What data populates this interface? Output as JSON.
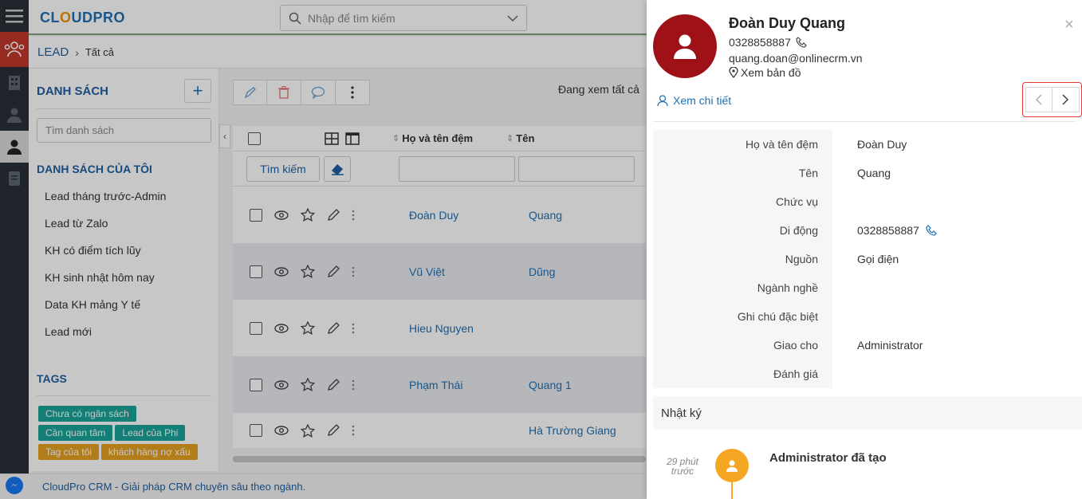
{
  "app": {
    "logo_text": "CLOUDPRO",
    "search_placeholder": "Nhập để tìm kiếm"
  },
  "breadcrumb": {
    "module": "LEAD",
    "view": "Tất cả"
  },
  "sidebar": {
    "title": "DANH SÁCH",
    "search_placeholder": "Tìm danh sách",
    "my_lists_title": "DANH SÁCH CỦA TÔI",
    "lists": [
      "Lead tháng trước-Admin",
      "Lead từ Zalo",
      "KH có điểm tích lũy",
      "KH sinh nhật hôm nay",
      "Data KH mảng Y tế",
      "Lead mới"
    ],
    "tags_title": "TAGS",
    "tags": [
      {
        "label": "Chưa có ngân sách",
        "color": "#1aa398"
      },
      {
        "label": "Cần quan tâm",
        "color": "#1aa398"
      },
      {
        "label": "Lead của Phi",
        "color": "#1aa398"
      },
      {
        "label": "Tag của tôi",
        "color": "#e6a020"
      },
      {
        "label": "khách hàng nợ xấu",
        "color": "#e6a020"
      }
    ]
  },
  "list": {
    "viewing_text": "Đang xem tất cả",
    "columns": {
      "middle_name": "Họ và tên đệm",
      "first_name": "Tên"
    },
    "search_button": "Tìm kiếm",
    "rows": [
      {
        "middle": "Đoàn Duy",
        "first": "Quang"
      },
      {
        "middle": "Vũ Việt",
        "first": "Dũng"
      },
      {
        "middle": "Hieu Nguyen",
        "first": ""
      },
      {
        "middle": "Phạm Thái",
        "first": "Quang 1"
      },
      {
        "middle": "",
        "first": "Hà Trường Giang"
      }
    ]
  },
  "footer": {
    "text": "CloudPro CRM - Giải pháp CRM chuyên sâu theo ngành."
  },
  "detail": {
    "name": "Đoàn Duy Quang",
    "phone": "0328858887",
    "email": "quang.doan@onlinecrm.vn",
    "map_link": "Xem bản đồ",
    "view_detail": "Xem chi tiết",
    "fields": [
      {
        "label": "Họ và tên đệm",
        "value": "Đoàn Duy"
      },
      {
        "label": "Tên",
        "value": "Quang"
      },
      {
        "label": "Chức vụ",
        "value": ""
      },
      {
        "label": "Di động",
        "value": "0328858887"
      },
      {
        "label": "Nguồn",
        "value": "Gọi điện"
      },
      {
        "label": "Ngành nghề",
        "value": ""
      },
      {
        "label": "Ghi chú đặc biệt",
        "value": ""
      },
      {
        "label": "Giao cho",
        "value": "Administrator"
      },
      {
        "label": "Đánh giá",
        "value": ""
      }
    ],
    "log_title": "Nhật ký",
    "log_entry": {
      "time": "29 phút trước",
      "text": "Administrator đã tạo"
    }
  },
  "colors": {
    "brand": "#1f6fb2",
    "avatar": "#9e1116",
    "highlight": "#e53935",
    "timeline": "#f5a623"
  }
}
